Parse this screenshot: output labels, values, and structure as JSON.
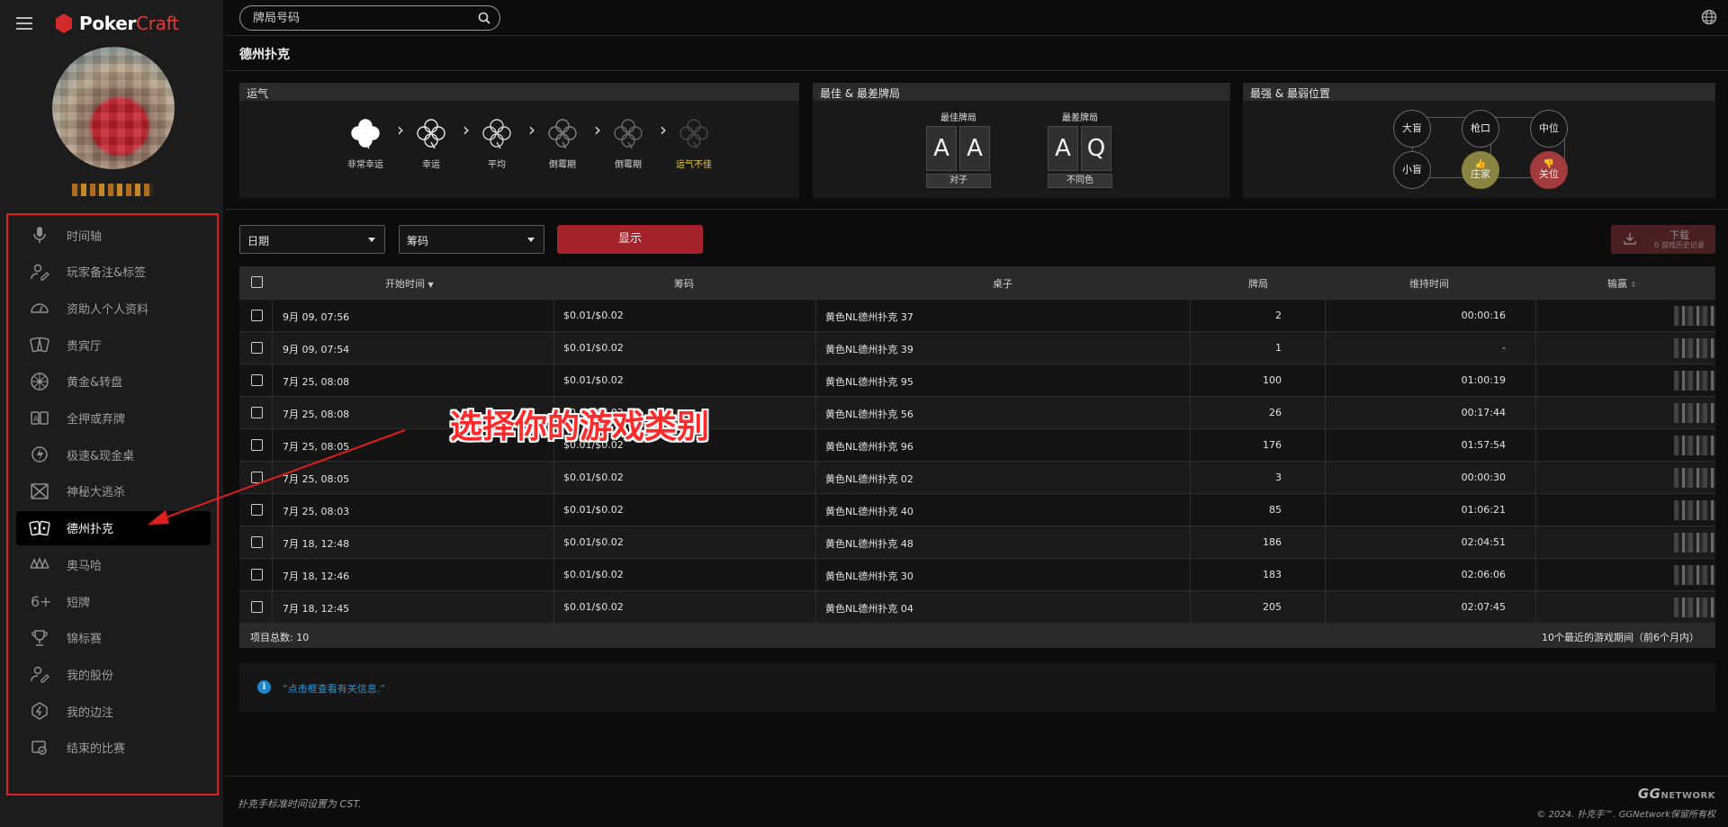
{
  "app": {
    "logo_word1": "Poker",
    "logo_word2": "Craft",
    "brand_color": "#d32b2b"
  },
  "sidebar": {
    "items": [
      {
        "label": "时间轴",
        "icon": "microphone-icon"
      },
      {
        "label": "玩家备注&标签",
        "icon": "user-edit-icon"
      },
      {
        "label": "资助人个人资料",
        "icon": "gauge-icon"
      },
      {
        "label": "贵宾厅",
        "icon": "cards-icon"
      },
      {
        "label": "黄金&转盘",
        "icon": "wheel-icon"
      },
      {
        "label": "全押或弃牌",
        "icon": "all-in-icon"
      },
      {
        "label": "极速&现金桌",
        "icon": "rush-icon"
      },
      {
        "label": "神秘大逃杀",
        "icon": "battle-royale-icon"
      },
      {
        "label": "德州扑克",
        "icon": "holdem-cards-icon"
      },
      {
        "label": "奥马哈",
        "icon": "omaha-cards-icon"
      },
      {
        "label": "短牌",
        "icon": "six-plus-icon"
      },
      {
        "label": "锦标赛",
        "icon": "trophy-icon"
      },
      {
        "label": "我的股份",
        "icon": "stake-icon"
      },
      {
        "label": "我的边注",
        "icon": "side-bet-icon"
      },
      {
        "label": "结束的比赛",
        "icon": "finished-games-icon"
      }
    ],
    "active_index": 8
  },
  "search": {
    "placeholder": "牌局号码"
  },
  "page": {
    "title": "德州扑克"
  },
  "luck": {
    "heading": "运气",
    "steps": [
      "非常幸运",
      "幸运",
      "平均",
      "倒霉期",
      "倒霉期",
      "运气不佳"
    ],
    "highlight_index": 5,
    "highlight_color": "#f0d43a"
  },
  "best_worst": {
    "heading": "最佳 & 最差牌局",
    "best_caption": "最佳牌局",
    "best_cards": [
      "A",
      "A"
    ],
    "best_label": "对子",
    "worst_caption": "最差牌局",
    "worst_cards": [
      "A",
      "Q"
    ],
    "worst_label": "不同色"
  },
  "positions": {
    "heading": "最强 & 最弱位置",
    "big_blind": "大盲",
    "utg": "枪口",
    "middle": "中位",
    "small_blind": "小盲",
    "button": "庄家",
    "cutoff": "关位",
    "best_color": "#8a8442",
    "worst_color": "#a33a3e"
  },
  "filters": {
    "date_label": "日期",
    "stakes_label": "筹码",
    "show_button": "显示",
    "download_label": "下载",
    "download_sub": "0 游戏历史记录",
    "show_color": "#a4232a"
  },
  "table": {
    "headers": {
      "start_time": "开始时间",
      "stakes": "筹码",
      "table": "桌子",
      "hands": "牌局",
      "duration": "维持时间",
      "winloss": "输赢"
    },
    "rows": [
      {
        "time": "9月 09, 07:56",
        "stakes": "$0.01/$0.02",
        "table": "黄色NL德州扑克 37",
        "hands": "2",
        "duration": "00:00:16"
      },
      {
        "time": "9月 09, 07:54",
        "stakes": "$0.01/$0.02",
        "table": "黄色NL德州扑克 39",
        "hands": "1",
        "duration": "-"
      },
      {
        "time": "7月 25, 08:08",
        "stakes": "$0.01/$0.02",
        "table": "黄色NL德州扑克 95",
        "hands": "100",
        "duration": "01:00:19"
      },
      {
        "time": "7月 25, 08:08",
        "stakes": "$0.01/$0.02",
        "table": "黄色NL德州扑克 56",
        "hands": "26",
        "duration": "00:17:44"
      },
      {
        "time": "7月 25, 08:05",
        "stakes": "$0.01/$0.02",
        "table": "黄色NL德州扑克 96",
        "hands": "176",
        "duration": "01:57:54"
      },
      {
        "time": "7月 25, 08:05",
        "stakes": "$0.01/$0.02",
        "table": "黄色NL德州扑克 02",
        "hands": "3",
        "duration": "00:00:30"
      },
      {
        "time": "7月 25, 08:03",
        "stakes": "$0.01/$0.02",
        "table": "黄色NL德州扑克 40",
        "hands": "85",
        "duration": "01:06:21"
      },
      {
        "time": "7月 18, 12:48",
        "stakes": "$0.01/$0.02",
        "table": "黄色NL德州扑克 48",
        "hands": "186",
        "duration": "02:04:51"
      },
      {
        "time": "7月 18, 12:46",
        "stakes": "$0.01/$0.02",
        "table": "黄色NL德州扑克 30",
        "hands": "183",
        "duration": "02:06:06"
      },
      {
        "time": "7月 18, 12:45",
        "stakes": "$0.01/$0.02",
        "table": "黄色NL德州扑克 04",
        "hands": "205",
        "duration": "02:07:45"
      }
    ],
    "footer_count": "项目总数: 10",
    "footer_note": "10个最近的游戏期间（前6个月内）"
  },
  "info": {
    "icon": "i",
    "text": "“点击框查看有关信息.”"
  },
  "footer": {
    "timezone_note": "扑克手标准时间设置为 CST.",
    "brand_gg": "GG",
    "brand_network": "NETWORK",
    "copyright": "© 2024. 扑克手™. GGNetwork保留所有权"
  },
  "annotation": {
    "text": "选择你的游戏类别",
    "color": "#ff2a2a"
  }
}
